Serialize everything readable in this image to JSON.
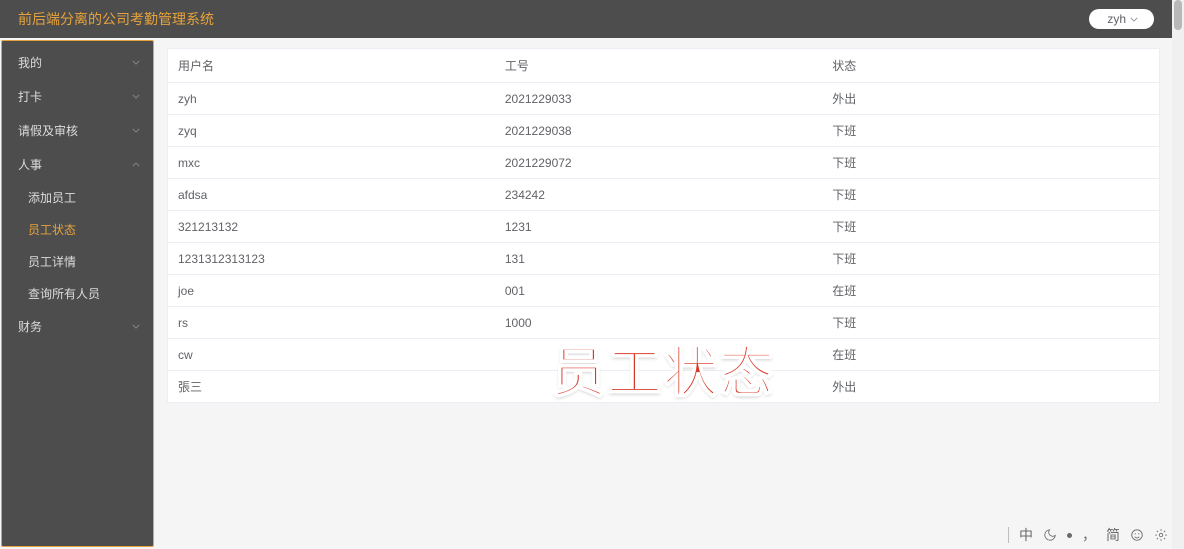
{
  "header": {
    "title": "前后端分离的公司考勤管理系统",
    "user": "zyh"
  },
  "sidebar": {
    "items": [
      {
        "label": "我的",
        "k": "mine"
      },
      {
        "label": "打卡",
        "k": "punch"
      },
      {
        "label": "请假及审核",
        "k": "leave"
      },
      {
        "label": "人事",
        "k": "hr"
      },
      {
        "label": "财务",
        "k": "finance"
      }
    ],
    "hr_children": [
      {
        "label": "添加员工",
        "k": "add-emp"
      },
      {
        "label": "员工状态",
        "k": "emp-status",
        "active": true
      },
      {
        "label": "员工详情",
        "k": "emp-detail"
      },
      {
        "label": "查询所有人员",
        "k": "query-all"
      }
    ]
  },
  "table": {
    "columns": [
      "用户名",
      "工号",
      "状态"
    ],
    "rows": [
      {
        "username": "zyh",
        "code": "2021229033",
        "status": "外出"
      },
      {
        "username": "zyq",
        "code": "2021229038",
        "status": "下班"
      },
      {
        "username": "mxc",
        "code": "2021229072",
        "status": "下班"
      },
      {
        "username": "afdsa",
        "code": "234242",
        "status": "下班"
      },
      {
        "username": "321213132",
        "code": "1231",
        "status": "下班"
      },
      {
        "username": "1231312313123",
        "code": "131",
        "status": "下班"
      },
      {
        "username": "joe",
        "code": "001",
        "status": "在班"
      },
      {
        "username": "rs",
        "code": "1000",
        "status": "下班"
      },
      {
        "username": "cw",
        "code": "",
        "status": "在班"
      },
      {
        "username": "張三",
        "code": "",
        "status": "外出"
      }
    ]
  },
  "watermark": "员工状态",
  "ime": {
    "lang": "中",
    "mode": "简"
  }
}
